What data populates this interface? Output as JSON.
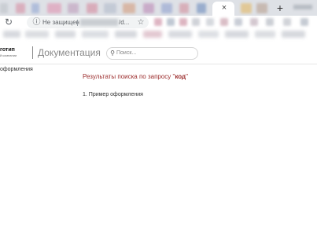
{
  "browser": {
    "tab_close_glyph": "×",
    "new_tab_glyph": "+",
    "address_bar": {
      "security_label": "Не защищен",
      "url_tail": "/d..."
    }
  },
  "header": {
    "logo_main": "готип",
    "logo_sub": "й компании",
    "docs_title": "Документация",
    "search": {
      "placeholder": "Поиск..."
    }
  },
  "sidebar": {
    "items": [
      {
        "label": "оформления"
      }
    ]
  },
  "results": {
    "heading_prefix": "Результаты поиска по запросу \"",
    "query": "код",
    "heading_suffix": "\"",
    "items": [
      {
        "label": "1.  Пример оформления"
      }
    ]
  },
  "icons": {
    "reload": "reload-icon",
    "info": "info-icon",
    "star": "star-icon",
    "search": "search-icon",
    "close": "close-icon",
    "plus": "plus-icon"
  }
}
